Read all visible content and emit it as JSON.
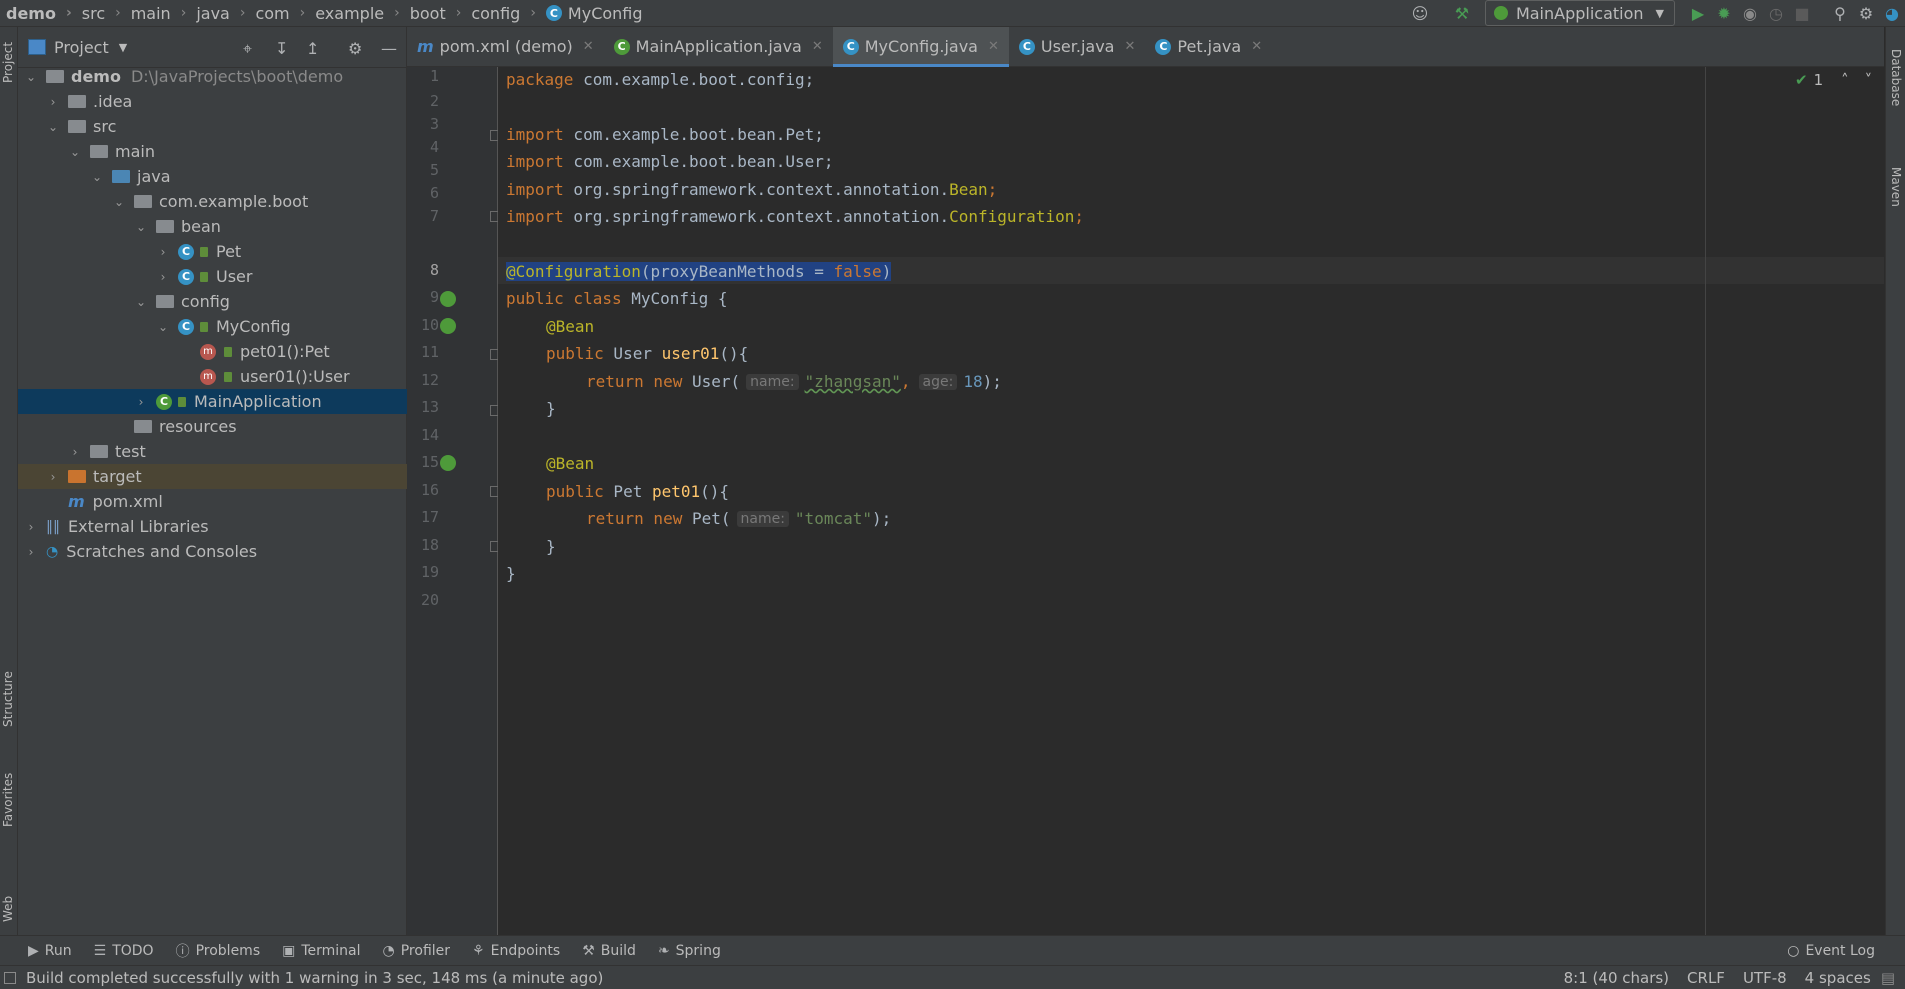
{
  "breadcrumb": [
    "demo",
    "src",
    "main",
    "java",
    "com",
    "example",
    "boot",
    "config",
    "MyConfig"
  ],
  "toolbar": {
    "run_config": "MainApplication"
  },
  "left_stripe": {
    "project": "Project",
    "structure": "Structure",
    "favorites": "Favorites",
    "web": "Web"
  },
  "right_stripe": {
    "database": "Database",
    "maven": "Maven"
  },
  "project_panel": {
    "title": "Project",
    "tree": [
      {
        "label": "demo",
        "path": "D:\\JavaProjects\\boot\\demo"
      },
      {
        "label": ".idea"
      },
      {
        "label": "src"
      },
      {
        "label": "main"
      },
      {
        "label": "java"
      },
      {
        "label": "com.example.boot"
      },
      {
        "label": "bean"
      },
      {
        "label": "Pet"
      },
      {
        "label": "User"
      },
      {
        "label": "config"
      },
      {
        "label": "MyConfig"
      },
      {
        "label": "pet01():Pet"
      },
      {
        "label": "user01():User"
      },
      {
        "label": "MainApplication"
      },
      {
        "label": "resources"
      },
      {
        "label": "test"
      },
      {
        "label": "target"
      },
      {
        "label": "pom.xml"
      },
      {
        "label": "External Libraries"
      },
      {
        "label": "Scratches and Consoles"
      }
    ]
  },
  "tabs": [
    {
      "label": "pom.xml (demo)"
    },
    {
      "label": "MainApplication.java"
    },
    {
      "label": "MyConfig.java"
    },
    {
      "label": "User.java"
    },
    {
      "label": "Pet.java"
    }
  ],
  "editor": {
    "inspection_count": "1",
    "line_numbers": [
      "1",
      "2",
      "3",
      "4",
      "5",
      "6",
      "7",
      "8",
      "9",
      "10",
      "11",
      "12",
      "13",
      "14",
      "15",
      "16",
      "17",
      "18",
      "19",
      "20"
    ],
    "code": {
      "l1_kw": "package",
      "l1_rest": " com.example.boot.config;",
      "import_kw": "import",
      "l3": " com.example.boot.bean.Pet;",
      "l4": " com.example.boot.bean.User;",
      "l5a": " org.springframework.context.annotation.",
      "l5b": "Bean",
      "l6a": " org.springframework.context.annotation.",
      "l6b": "Configuration",
      "semi": ";",
      "l8_ann": "@Configuration",
      "l8_param": "(proxyBeanMethods = ",
      "l8_false": "false",
      "l8_close": ")",
      "l9_kw": "public class",
      "l9_rest": " MyConfig {",
      "bean_ann": "@Bean",
      "l11_kw": "public",
      "l11_type": " User ",
      "l11_fn": "user01",
      "l11_rest": "(){",
      "return_kw": "return new",
      "l12_type": " User(",
      "hint_name": "name:",
      "l12_str": "\"zhangsan\"",
      "l12_comma": ",",
      "hint_age": "age:",
      "l12_num": "18",
      "l12_end": ");",
      "brace": "}",
      "l16_kw": "public",
      "l16_type": " Pet ",
      "l16_fn": "pet01",
      "l16_rest": "(){",
      "l17_type": " Pet(",
      "l17_str": "\"tomcat\"",
      "l17_end": ");"
    }
  },
  "bottom_tools": [
    "Run",
    "TODO",
    "Problems",
    "Terminal",
    "Profiler",
    "Endpoints",
    "Build",
    "Spring"
  ],
  "event_log": "Event Log",
  "status": {
    "message": "Build completed successfully with 1 warning in 3 sec, 148 ms (a minute ago)",
    "position": "8:1 (40 chars)",
    "line_sep": "CRLF",
    "encoding": "UTF-8",
    "indent": "4 spaces"
  }
}
